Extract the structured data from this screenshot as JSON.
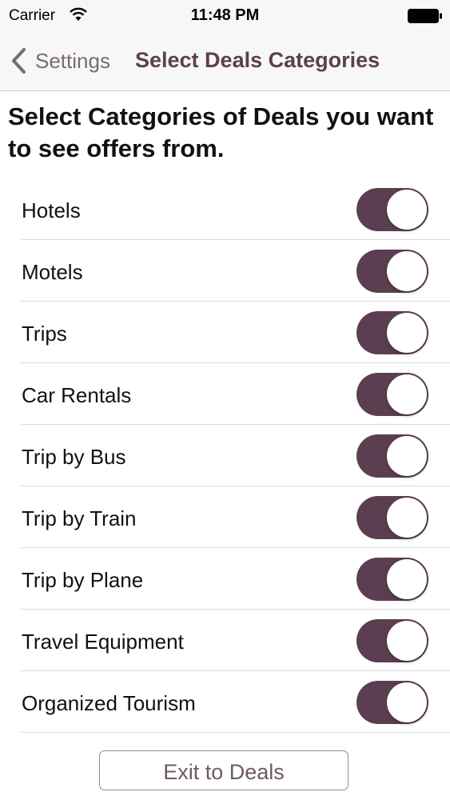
{
  "status_bar": {
    "carrier": "Carrier",
    "time": "11:48 PM",
    "wifi_icon": "wifi-icon",
    "battery_icon": "battery-icon"
  },
  "nav": {
    "back_label": "Settings",
    "back_icon": "chevron-left-icon",
    "title": "Select Deals Categories"
  },
  "heading": "Select Categories of Deals you want to see offers from.",
  "categories": [
    {
      "label": "Hotels",
      "enabled": true
    },
    {
      "label": "Motels",
      "enabled": true
    },
    {
      "label": "Trips",
      "enabled": true
    },
    {
      "label": "Car Rentals",
      "enabled": true
    },
    {
      "label": "Trip by Bus",
      "enabled": true
    },
    {
      "label": "Trip by Train",
      "enabled": true
    },
    {
      "label": "Trip by Plane",
      "enabled": true
    },
    {
      "label": "Travel Equipment",
      "enabled": true
    },
    {
      "label": "Organized Tourism",
      "enabled": true
    }
  ],
  "exit_button_label": "Exit to Deals",
  "colors": {
    "accent": "#5b3f50",
    "toggle_on": "#5b3f50",
    "bar_background": "#f7f7f7"
  }
}
